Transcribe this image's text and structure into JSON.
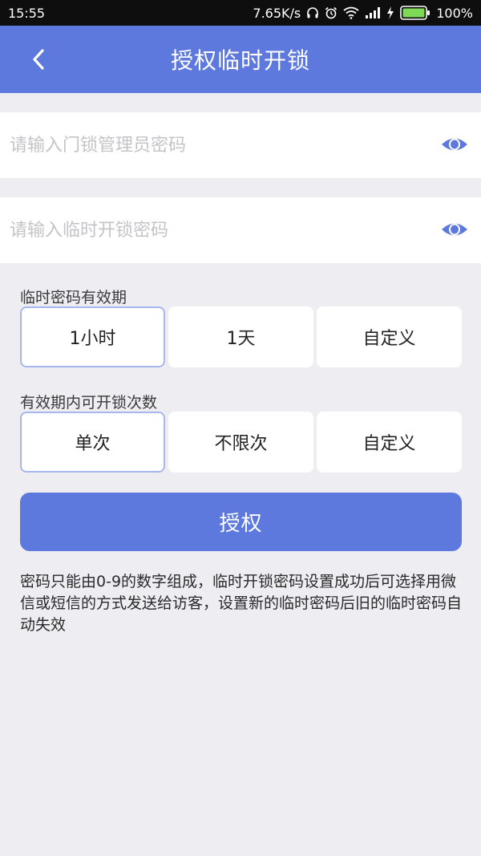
{
  "status_bar": {
    "time": "15:55",
    "speed": "7.65K/s",
    "battery": "100%",
    "icons": [
      "headphones-icon",
      "alarm-icon",
      "wifi-icon",
      "signal-icon",
      "charging-icon",
      "battery-icon"
    ]
  },
  "header": {
    "back_icon": "chevron-left-icon",
    "title": "授权临时开锁"
  },
  "fields": {
    "admin_password": {
      "placeholder": "请输入门锁管理员密码",
      "value": "",
      "icon": "eye-icon"
    },
    "temp_password": {
      "placeholder": "请输入临时开锁密码",
      "value": "",
      "icon": "eye-icon"
    }
  },
  "validity": {
    "label": "临时密码有效期",
    "options": [
      "1小时",
      "1天",
      "自定义"
    ],
    "selected": "1小时"
  },
  "unlock_count": {
    "label": "有效期内可开锁次数",
    "options": [
      "单次",
      "不限次",
      "自定义"
    ],
    "selected": "单次"
  },
  "authorize_button": "授权",
  "note": "密码只能由0-9的数字组成，临时开锁密码设置成功后可选择用微信或短信的方式发送给访客，设置新的临时密码后旧的临时密码自动失效",
  "colors": {
    "accent": "#5E79DE",
    "background": "#EEEEF2",
    "selected_border": "#A9B6EC",
    "status_bar": "#0E0E0E"
  }
}
